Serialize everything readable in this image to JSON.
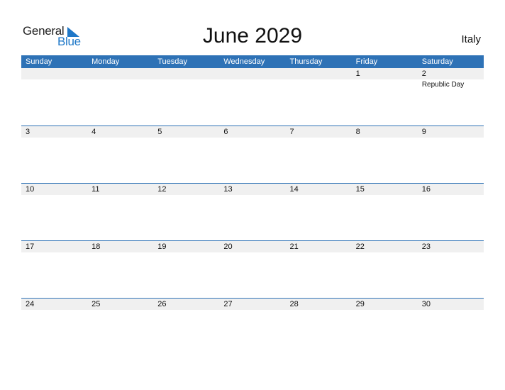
{
  "brand": {
    "name_part1": "General",
    "name_part2": "Blue",
    "accent": "#2e72b6"
  },
  "title": "June 2029",
  "country": "Italy",
  "weekdays": [
    "Sunday",
    "Monday",
    "Tuesday",
    "Wednesday",
    "Thursday",
    "Friday",
    "Saturday"
  ],
  "weeks": [
    [
      "",
      "",
      "",
      "",
      "",
      "1",
      "2"
    ],
    [
      "3",
      "4",
      "5",
      "6",
      "7",
      "8",
      "9"
    ],
    [
      "10",
      "11",
      "12",
      "13",
      "14",
      "15",
      "16"
    ],
    [
      "17",
      "18",
      "19",
      "20",
      "21",
      "22",
      "23"
    ],
    [
      "24",
      "25",
      "26",
      "27",
      "28",
      "29",
      "30"
    ]
  ],
  "holidays": [
    {
      "date": "2",
      "week": 0,
      "day": 6,
      "name": "Republic Day"
    }
  ]
}
